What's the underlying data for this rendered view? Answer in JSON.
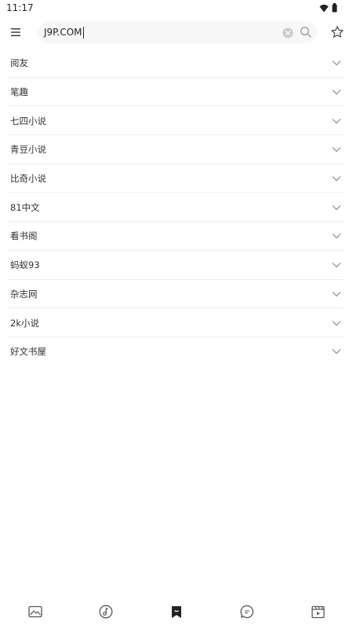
{
  "status_bar": {
    "time": "11:17",
    "icons": [
      "wifi-icon",
      "battery-icon"
    ]
  },
  "top_bar": {
    "menu_icon": "menu-icon",
    "search": {
      "value": "J9P.COM",
      "clear_icon": "clear-icon",
      "search_icon": "search-icon"
    },
    "favorite_icon": "star-icon"
  },
  "site_list": [
    {
      "label": "阅友"
    },
    {
      "label": "笔趣"
    },
    {
      "label": "七四小说"
    },
    {
      "label": "青豆小说"
    },
    {
      "label": "比奇小说"
    },
    {
      "label": "81中文"
    },
    {
      "label": "看书阁"
    },
    {
      "label": "蚂蚁93"
    },
    {
      "label": "杂志网"
    },
    {
      "label": "2k小说"
    },
    {
      "label": "好文书屋"
    }
  ],
  "bottom_nav": [
    {
      "icon": "image-icon",
      "active": false
    },
    {
      "icon": "music-icon",
      "active": false
    },
    {
      "icon": "bookmark-icon",
      "active": true
    },
    {
      "icon": "chat-icon",
      "active": false
    },
    {
      "icon": "video-icon",
      "active": false
    }
  ],
  "colors": {
    "text": "#333333",
    "divider": "#eeeeee",
    "search_bg": "#f7f7f7",
    "icon": "#555555",
    "active_icon": "#222222"
  }
}
